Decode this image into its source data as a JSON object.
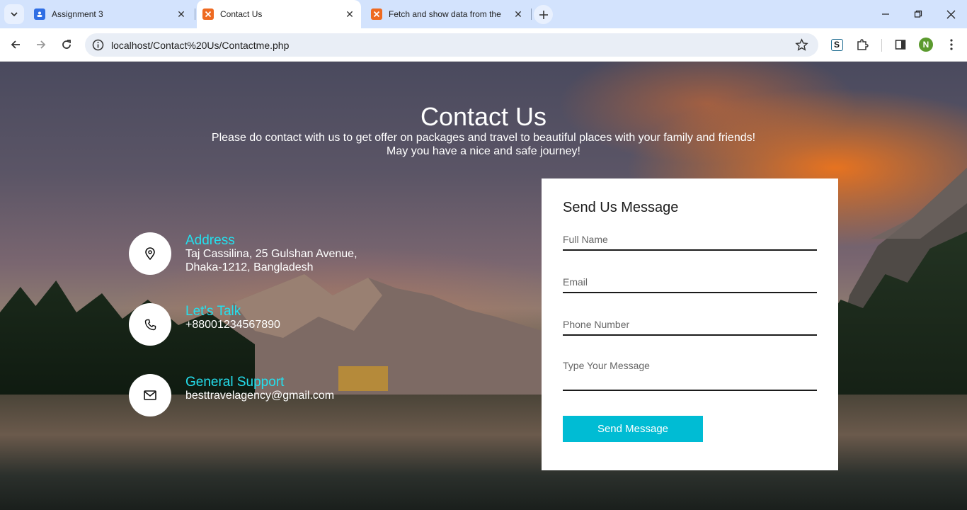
{
  "browser": {
    "tabs": [
      {
        "title": "Assignment 3",
        "favicon_color": "#2f6ee4"
      },
      {
        "title": "Contact Us",
        "favicon_color": "#ee6a21"
      },
      {
        "title": "Fetch and show data from the",
        "favicon_color": "#ee6a21"
      }
    ],
    "url": "localhost/Contact%20Us/Contactme.php",
    "profile_initial": "N",
    "extension_letter": "S"
  },
  "page": {
    "title": "Contact Us",
    "subtitle_line1": "Please do contact with us to get offer on packages and travel to beautiful places with your family and friends!",
    "subtitle_line2": "May you have a nice and safe journey!",
    "info": [
      {
        "label": "Address",
        "value": "Taj Cassilina, 25 Gulshan Avenue,\nDhaka-1212, Bangladesh",
        "icon": "map-pin-icon"
      },
      {
        "label": "Let's Talk",
        "value": "+88001234567890",
        "icon": "phone-icon"
      },
      {
        "label": "General Support",
        "value": "besttravelagency@gmail.com",
        "icon": "mail-icon"
      }
    ],
    "form": {
      "heading": "Send Us Message",
      "full_name_placeholder": "Full Name",
      "email_placeholder": "Email",
      "phone_placeholder": "Phone Number",
      "message_placeholder": "Type Your Message",
      "submit_label": "Send Message"
    },
    "colors": {
      "accent_cyan": "#24e0ee",
      "button": "#00bcd4"
    }
  }
}
